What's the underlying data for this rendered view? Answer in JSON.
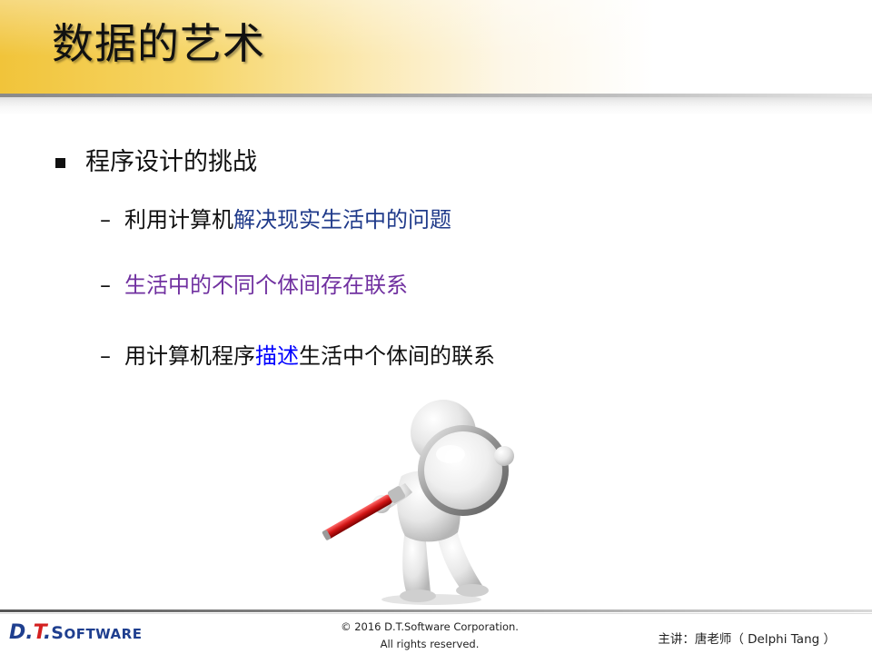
{
  "title": "数据的艺术",
  "level1": {
    "text": "程序设计的挑战"
  },
  "items": [
    {
      "dash": "–",
      "segments": [
        {
          "text": "利用计算机",
          "color": "#111111"
        },
        {
          "text": "解决现实生活中的问题",
          "color": "#1f3a8a"
        }
      ]
    },
    {
      "dash": "–",
      "segments": [
        {
          "text": "生活中的不同个体间存在联系",
          "color": "#7030a0"
        }
      ]
    },
    {
      "dash": "–",
      "segments": [
        {
          "text": "用计算机程序",
          "color": "#111111"
        },
        {
          "text": "描述",
          "color": "#0000ff"
        },
        {
          "text": "生活中个体间的联系",
          "color": "#111111"
        }
      ]
    }
  ],
  "figure": {
    "icon": "person-with-magnifying-glass-icon"
  },
  "footer": {
    "logo": {
      "dt_d": "D.",
      "dt_t": "T",
      "dt_dot": ".",
      "sw_s": "S",
      "sw_rest": "OFTWARE"
    },
    "copyright_line1": "© 2016 D.T.Software Corporation.",
    "copyright_line2": "All rights reserved.",
    "lecturer": "主讲：唐老师（ Delphi Tang ）"
  },
  "colors": {
    "banner_gold": "#f1c43a",
    "logo_blue": "#1f3f8f",
    "logo_red": "#d42020"
  }
}
